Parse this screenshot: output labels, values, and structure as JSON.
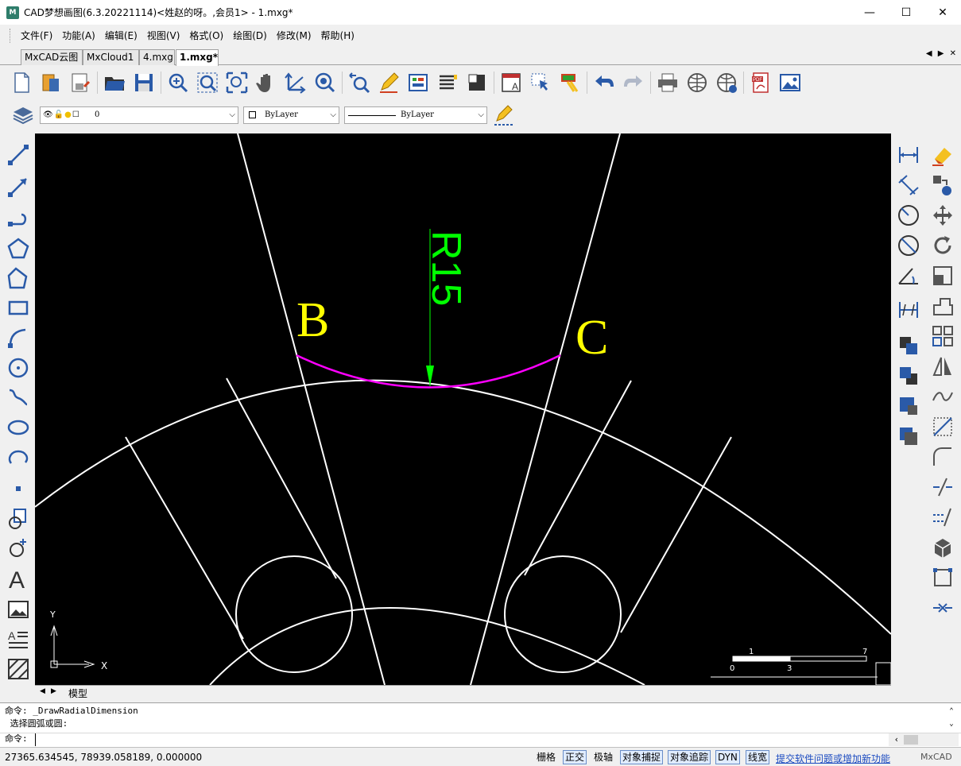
{
  "titlebar": {
    "title": "CAD梦想画图(6.3.20221114)<姓赵的呀。,会员1> - 1.mxg*",
    "minimize": "—",
    "maximize": "☐",
    "close": "✕"
  },
  "menu": [
    "文件(F)",
    "功能(A)",
    "编辑(E)",
    "视图(V)",
    "格式(O)",
    "绘图(D)",
    "修改(M)",
    "帮助(H)"
  ],
  "doc_tabs": [
    "MxCAD云图",
    "MxCloud1",
    "4.mxg",
    "1.mxg*"
  ],
  "tab_nav": "◀ ▶ ✕",
  "layer_combo": {
    "value": "0"
  },
  "color_combo": {
    "value": "ByLayer"
  },
  "linetype_combo": {
    "value": "ByLayer"
  },
  "drawing": {
    "label_b": "B",
    "label_c": "C",
    "dimension_text": "R15",
    "ucs_y": "Y",
    "ucs_x": "X",
    "scale_bar": {
      "top_left": "1",
      "top_right": "7",
      "bottom_left": "0",
      "bottom_mid": "3"
    },
    "colors": {
      "background": "#000000",
      "geometry": "#ffffff",
      "arc": "#ff00ff",
      "dimension": "#00ff00",
      "labels": "#ffff00"
    }
  },
  "layout_tabs": {
    "model": "模型"
  },
  "command": {
    "line1": "命令: _DrawRadialDimension",
    "line2": " 选择圆弧或圆:",
    "prompt": "命令:"
  },
  "status": {
    "coords": "27365.634545,  78939.058189,  0.000000",
    "grid": "栅格",
    "ortho": "正交",
    "polar": "极轴",
    "osnap": "对象捕捉",
    "otrack": "对象追踪",
    "dyn": "DYN",
    "lineweight": "线宽",
    "feedback": "提交软件问题或增加新功能",
    "brand": "MxCAD"
  }
}
